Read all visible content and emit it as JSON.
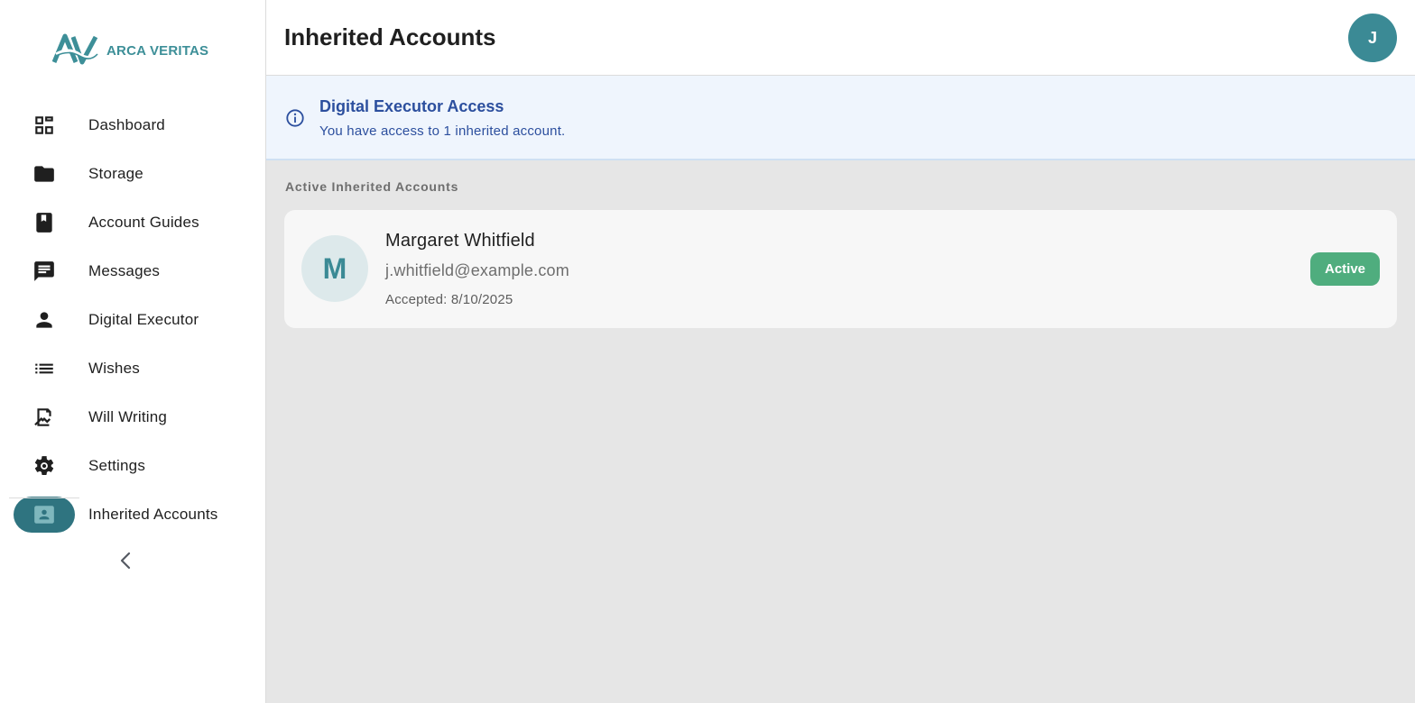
{
  "brand": {
    "name": "ARCA VERITAS",
    "accent_color": "#3d8f98"
  },
  "sidebar": {
    "items": [
      {
        "label": "Dashboard",
        "icon": "dashboard-icon"
      },
      {
        "label": "Storage",
        "icon": "folder-icon"
      },
      {
        "label": "Account Guides",
        "icon": "book-icon"
      },
      {
        "label": "Messages",
        "icon": "message-icon"
      },
      {
        "label": "Digital Executor",
        "icon": "person-icon"
      },
      {
        "label": "Wishes",
        "icon": "list-icon"
      },
      {
        "label": "Will Writing",
        "icon": "signature-icon"
      },
      {
        "label": "Settings",
        "icon": "gear-icon"
      },
      {
        "label": "Inherited Accounts",
        "icon": "contact-card-icon",
        "active": true
      }
    ],
    "collapse_icon": "chevron-left-icon"
  },
  "header": {
    "title": "Inherited Accounts",
    "avatar_initial": "J"
  },
  "banner": {
    "icon": "info-icon",
    "title": "Digital Executor Access",
    "text": "You have access to 1 inherited account."
  },
  "main": {
    "section_label": "Active Inherited Accounts",
    "accounts": [
      {
        "initial": "M",
        "name": "Margaret Whitfield",
        "email": "j.whitfield@example.com",
        "accepted": "Accepted: 8/10/2025",
        "status": "Active",
        "status_color": "#4fad7e"
      }
    ]
  }
}
